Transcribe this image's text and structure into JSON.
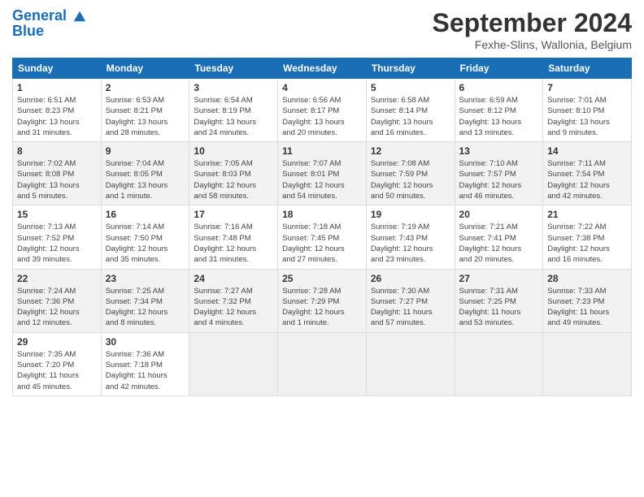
{
  "header": {
    "logo_line1": "General",
    "logo_line2": "Blue",
    "title": "September 2024",
    "location": "Fexhe-Slins, Wallonia, Belgium"
  },
  "days_of_week": [
    "Sunday",
    "Monday",
    "Tuesday",
    "Wednesday",
    "Thursday",
    "Friday",
    "Saturday"
  ],
  "weeks": [
    [
      {
        "day": "1",
        "info": "Sunrise: 6:51 AM\nSunset: 8:23 PM\nDaylight: 13 hours\nand 31 minutes."
      },
      {
        "day": "2",
        "info": "Sunrise: 6:53 AM\nSunset: 8:21 PM\nDaylight: 13 hours\nand 28 minutes."
      },
      {
        "day": "3",
        "info": "Sunrise: 6:54 AM\nSunset: 8:19 PM\nDaylight: 13 hours\nand 24 minutes."
      },
      {
        "day": "4",
        "info": "Sunrise: 6:56 AM\nSunset: 8:17 PM\nDaylight: 13 hours\nand 20 minutes."
      },
      {
        "day": "5",
        "info": "Sunrise: 6:58 AM\nSunset: 8:14 PM\nDaylight: 13 hours\nand 16 minutes."
      },
      {
        "day": "6",
        "info": "Sunrise: 6:59 AM\nSunset: 8:12 PM\nDaylight: 13 hours\nand 13 minutes."
      },
      {
        "day": "7",
        "info": "Sunrise: 7:01 AM\nSunset: 8:10 PM\nDaylight: 13 hours\nand 9 minutes."
      }
    ],
    [
      {
        "day": "8",
        "info": "Sunrise: 7:02 AM\nSunset: 8:08 PM\nDaylight: 13 hours\nand 5 minutes."
      },
      {
        "day": "9",
        "info": "Sunrise: 7:04 AM\nSunset: 8:05 PM\nDaylight: 13 hours\nand 1 minute."
      },
      {
        "day": "10",
        "info": "Sunrise: 7:05 AM\nSunset: 8:03 PM\nDaylight: 12 hours\nand 58 minutes."
      },
      {
        "day": "11",
        "info": "Sunrise: 7:07 AM\nSunset: 8:01 PM\nDaylight: 12 hours\nand 54 minutes."
      },
      {
        "day": "12",
        "info": "Sunrise: 7:08 AM\nSunset: 7:59 PM\nDaylight: 12 hours\nand 50 minutes."
      },
      {
        "day": "13",
        "info": "Sunrise: 7:10 AM\nSunset: 7:57 PM\nDaylight: 12 hours\nand 46 minutes."
      },
      {
        "day": "14",
        "info": "Sunrise: 7:11 AM\nSunset: 7:54 PM\nDaylight: 12 hours\nand 42 minutes."
      }
    ],
    [
      {
        "day": "15",
        "info": "Sunrise: 7:13 AM\nSunset: 7:52 PM\nDaylight: 12 hours\nand 39 minutes."
      },
      {
        "day": "16",
        "info": "Sunrise: 7:14 AM\nSunset: 7:50 PM\nDaylight: 12 hours\nand 35 minutes."
      },
      {
        "day": "17",
        "info": "Sunrise: 7:16 AM\nSunset: 7:48 PM\nDaylight: 12 hours\nand 31 minutes."
      },
      {
        "day": "18",
        "info": "Sunrise: 7:18 AM\nSunset: 7:45 PM\nDaylight: 12 hours\nand 27 minutes."
      },
      {
        "day": "19",
        "info": "Sunrise: 7:19 AM\nSunset: 7:43 PM\nDaylight: 12 hours\nand 23 minutes."
      },
      {
        "day": "20",
        "info": "Sunrise: 7:21 AM\nSunset: 7:41 PM\nDaylight: 12 hours\nand 20 minutes."
      },
      {
        "day": "21",
        "info": "Sunrise: 7:22 AM\nSunset: 7:38 PM\nDaylight: 12 hours\nand 16 minutes."
      }
    ],
    [
      {
        "day": "22",
        "info": "Sunrise: 7:24 AM\nSunset: 7:36 PM\nDaylight: 12 hours\nand 12 minutes."
      },
      {
        "day": "23",
        "info": "Sunrise: 7:25 AM\nSunset: 7:34 PM\nDaylight: 12 hours\nand 8 minutes."
      },
      {
        "day": "24",
        "info": "Sunrise: 7:27 AM\nSunset: 7:32 PM\nDaylight: 12 hours\nand 4 minutes."
      },
      {
        "day": "25",
        "info": "Sunrise: 7:28 AM\nSunset: 7:29 PM\nDaylight: 12 hours\nand 1 minute."
      },
      {
        "day": "26",
        "info": "Sunrise: 7:30 AM\nSunset: 7:27 PM\nDaylight: 11 hours\nand 57 minutes."
      },
      {
        "day": "27",
        "info": "Sunrise: 7:31 AM\nSunset: 7:25 PM\nDaylight: 11 hours\nand 53 minutes."
      },
      {
        "day": "28",
        "info": "Sunrise: 7:33 AM\nSunset: 7:23 PM\nDaylight: 11 hours\nand 49 minutes."
      }
    ],
    [
      {
        "day": "29",
        "info": "Sunrise: 7:35 AM\nSunset: 7:20 PM\nDaylight: 11 hours\nand 45 minutes."
      },
      {
        "day": "30",
        "info": "Sunrise: 7:36 AM\nSunset: 7:18 PM\nDaylight: 11 hours\nand 42 minutes."
      },
      {
        "day": "",
        "info": ""
      },
      {
        "day": "",
        "info": ""
      },
      {
        "day": "",
        "info": ""
      },
      {
        "day": "",
        "info": ""
      },
      {
        "day": "",
        "info": ""
      }
    ]
  ]
}
